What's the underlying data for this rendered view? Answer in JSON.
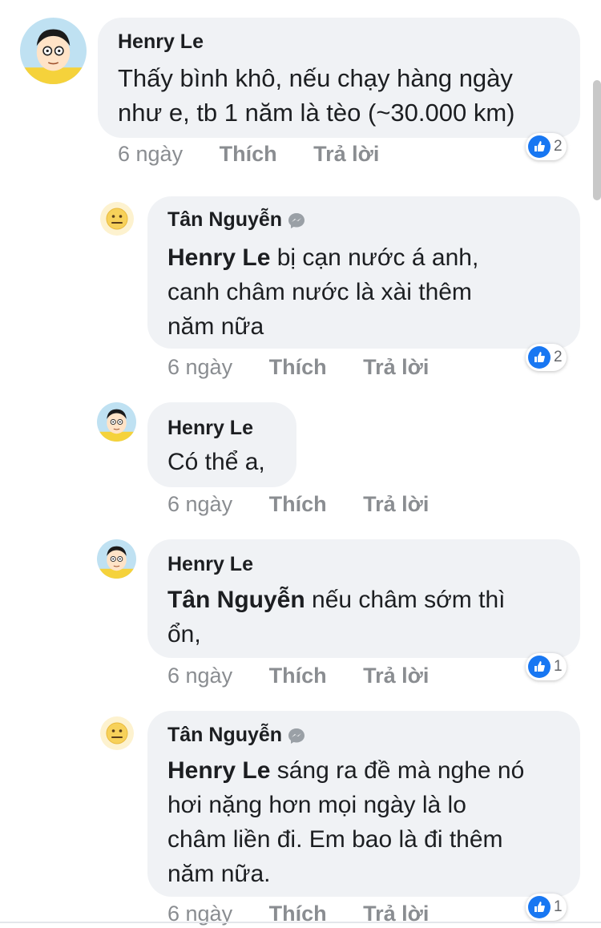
{
  "comments": [
    {
      "author": "Henry Le",
      "text": "Thấy bình khô, nếu chạy hàng ngày như e, tb 1 năm là tèo (~30.000 km)",
      "text_line1": "Thấy bình khô, nếu chạy hàng ngày",
      "text_line2": "như e, tb 1 năm là tèo (~30.000 km)",
      "time": "6 ngày",
      "like_label": "Thích",
      "reply_label": "Trả lời",
      "reaction_count": "2",
      "avatar": "doraemon-nobita-avatar"
    },
    {
      "author": "Tân Nguyễn",
      "author_badge": "messenger-icon",
      "mention": "Henry Le",
      "text_line1": " bị cạn nước á anh,",
      "text_line2": "canh châm nước là xài thêm",
      "text_line3": "năm nữa",
      "time": "6 ngày",
      "like_label": "Thích",
      "reply_label": "Trả lời",
      "reaction_count": "2",
      "avatar": "neutral-face-avatar"
    },
    {
      "author": "Henry Le",
      "text_line1": "Có thể a,",
      "time": "6 ngày",
      "like_label": "Thích",
      "reply_label": "Trả lời",
      "avatar": "doraemon-nobita-avatar"
    },
    {
      "author": "Henry Le",
      "mention": "Tân Nguyễn",
      "text_line1": " nếu châm sớm thì",
      "text_line2": "ổn,",
      "time": "6 ngày",
      "like_label": "Thích",
      "reply_label": "Trả lời",
      "reaction_count": "1",
      "avatar": "doraemon-nobita-avatar"
    },
    {
      "author": "Tân Nguyễn",
      "author_badge": "messenger-icon",
      "mention": "Henry Le",
      "text_line1": " sáng ra đề mà nghe nó",
      "text_line2": "hơi nặng hơn mọi ngày là lo",
      "text_line3": "châm liền đi. Em bao là đi thêm",
      "text_line4": "năm nữa.",
      "time": "6 ngày",
      "like_label": "Thích",
      "reply_label": "Trả lời",
      "reaction_count": "1",
      "avatar": "neutral-face-avatar"
    }
  ],
  "colors": {
    "bubble": "#f0f2f5",
    "like_blue": "#1877f2",
    "meta_gray": "#8a8d91",
    "emoji_yellow": "#f7d15a"
  }
}
